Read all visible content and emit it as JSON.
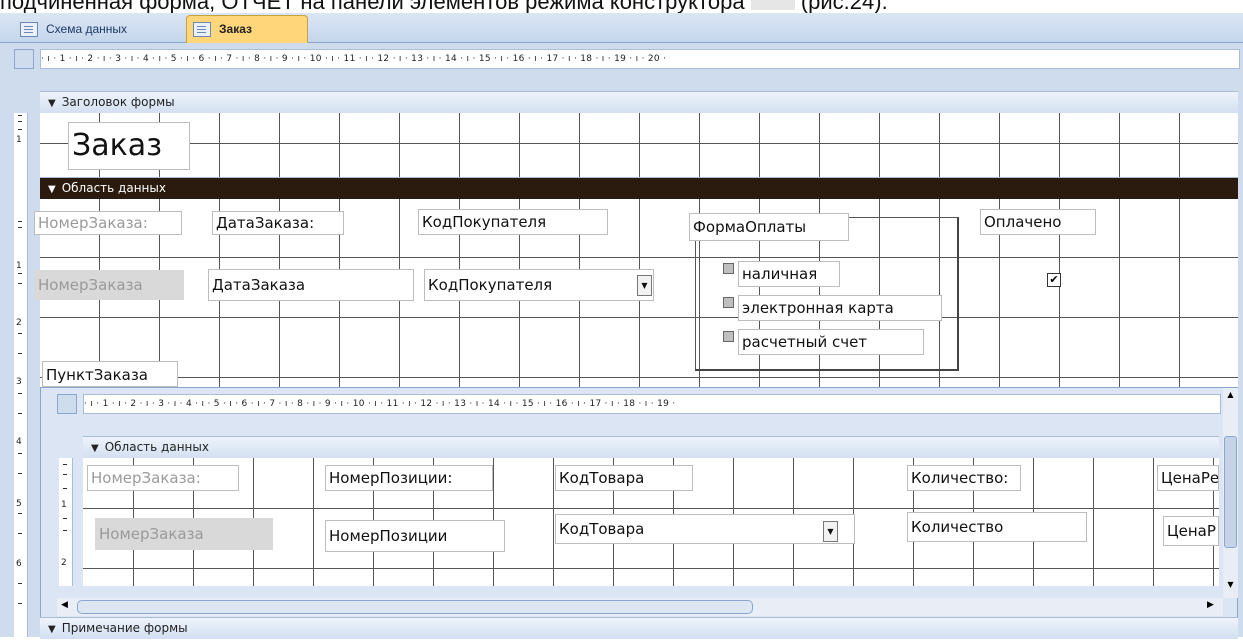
{
  "caption": {
    "before": "подчиненная форма, OTЧET на панели элементов режима конструктора",
    "after": "(рис.24)."
  },
  "tabs": [
    {
      "label": "Схема данных"
    },
    {
      "label": "Заказ"
    }
  ],
  "main_ruler": "· ı · 1 · ı · 2 · ı · 3 · ı · 4 · ı · 5 · ı · 6 · ı · 7 · ı · 8 · ı · 9 · ı · 10 · ı · 11 · ı · 12 · ı · 13 · ı · 14 · ı · 15 · ı · 16 · ı · 17 · ı · 18 · ı · 19 · ı · 20 ·",
  "sub_ruler": "· ı · 1 · ı · 2 · ı · 3 · ı · 4 · ı · 5 · ı · 6 · ı · 7 · ı · 8 · ı · 9 · ı · 10 · ı · 11 · ı · 12 · ı · 13 · ı · 14 · ı · 15 · ı · 16 · ı · 17 · ı · 18 · ı · 19 ·",
  "vruler_main": [
    "1",
    "1",
    "2",
    "3",
    "4",
    "5",
    "6"
  ],
  "vruler_sub": [
    "1",
    "2"
  ],
  "sections": {
    "form_header": "Заголовок формы",
    "detail": "Область данных",
    "sub_detail": "Область данных",
    "form_footer": "Примечание формы"
  },
  "header": {
    "title": "Заказ"
  },
  "detail": {
    "labels": {
      "order_no": "НомерЗаказа:",
      "order_date": "ДатаЗаказа:",
      "customer_code": "КодПокупателя",
      "payment_form": "ФормаОплаты",
      "paid": "Оплачено",
      "point": "ПунктЗаказа"
    },
    "fields": {
      "order_no": "НомерЗаказа",
      "order_date": "ДатаЗаказа",
      "customer_code": "КодПокупателя"
    },
    "payment_options": [
      "наличная",
      "электронная карта",
      "расчетный счет"
    ]
  },
  "subform": {
    "labels": {
      "order_no": "НомерЗаказа:",
      "position_no": "НомерПозиции:",
      "product_code": "КодТовара",
      "quantity": "Количество:",
      "price": "ЦенаРе"
    },
    "fields": {
      "order_no": "НомерЗаказа",
      "position_no": "НомерПозиции",
      "product_code": "КодТовара",
      "quantity": "Количество",
      "price": "ЦенаР"
    }
  },
  "colors": {
    "detail_band": "#2b1b0f",
    "tab_active": "#ffd67a",
    "surface": "#cfdcee"
  }
}
